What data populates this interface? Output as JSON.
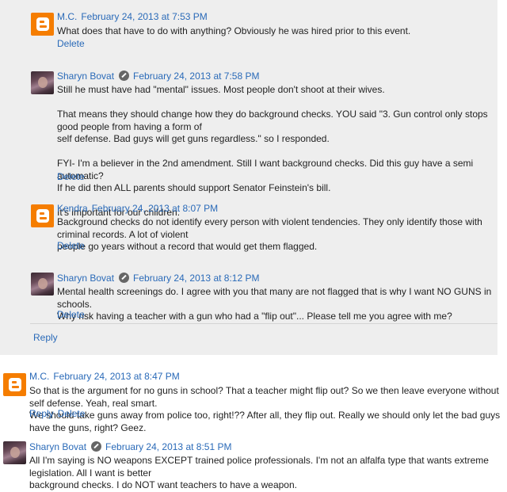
{
  "comments": [
    {
      "author": "M.C.",
      "avatar": "blogger-logo-icon",
      "date": "February 24, 2013 at 7:53 PM",
      "paragraphs": [
        [
          "What does that have to do with anything? Obviously he was hired prior to this event."
        ]
      ],
      "actions": [
        "Delete"
      ]
    },
    {
      "author": "Sharyn Bovat",
      "avatar": "user-photo",
      "date": "February 24, 2013 at 7:58 PM",
      "paragraphs": [
        [
          "Still he must have had \"mental\" issues. Most people don't shoot at their wives."
        ],
        [
          "That means they should change how they do background checks. YOU said \"3. Gun control only stops good people from having a form of",
          "self defense. Bad guys will get guns regardless.\" so I responded."
        ],
        [
          "FYI- I'm a believer in the 2nd amendment. Still I want background checks. Did this guy have a semi automatic?",
          "If he did then ALL parents should support Senator Feinstein's bill."
        ],
        [
          "It's important for our children."
        ]
      ],
      "actions": [
        "Delete"
      ]
    },
    {
      "author": "Kendra",
      "avatar": "blogger-logo-icon",
      "date": "February 24, 2013 at 8:07 PM",
      "paragraphs": [
        [
          "Background checks do not identify every person with violent tendencies. They only identify those with criminal records. A lot of violent",
          "people go years without a record that would get them flagged."
        ]
      ],
      "actions": [
        "Delete"
      ]
    },
    {
      "author": "Sharyn Bovat",
      "avatar": "user-photo",
      "date": "February 24, 2013 at 8:12 PM",
      "paragraphs": [
        [
          "Mental health screenings do. I agree with you that many are not flagged that is why I want NO GUNS in schools.",
          "Why risk having a teacher with a gun who had a \"flip out\"... Please tell me you agree with me?"
        ]
      ],
      "actions": [
        "Delete"
      ]
    },
    {
      "author": "M.C.",
      "avatar": "blogger-logo-icon",
      "date": "February 24, 2013 at 8:47 PM",
      "paragraphs": [
        [
          "So that is the argument for no guns in school? That a teacher might flip out? So we then leave everyone without self defense. Yeah, real smart.",
          "We should take guns away from police too, right!?? After all, they flip out. Really we should only let the bad guys have the guns, right? Geez."
        ]
      ],
      "actions": [
        "Reply",
        "Delete"
      ]
    },
    {
      "author": "Sharyn Bovat",
      "avatar": "user-photo",
      "date": "February 24, 2013 at 8:51 PM",
      "paragraphs": [
        [
          "All I'm saying is NO weapons EXCEPT trained police professionals. I'm not an alfalfa type that wants extreme legislation. All I want is better",
          "background checks. I do NOT want teachers to have a weapon."
        ]
      ],
      "actions": []
    }
  ],
  "thread_reply_label": "Reply"
}
